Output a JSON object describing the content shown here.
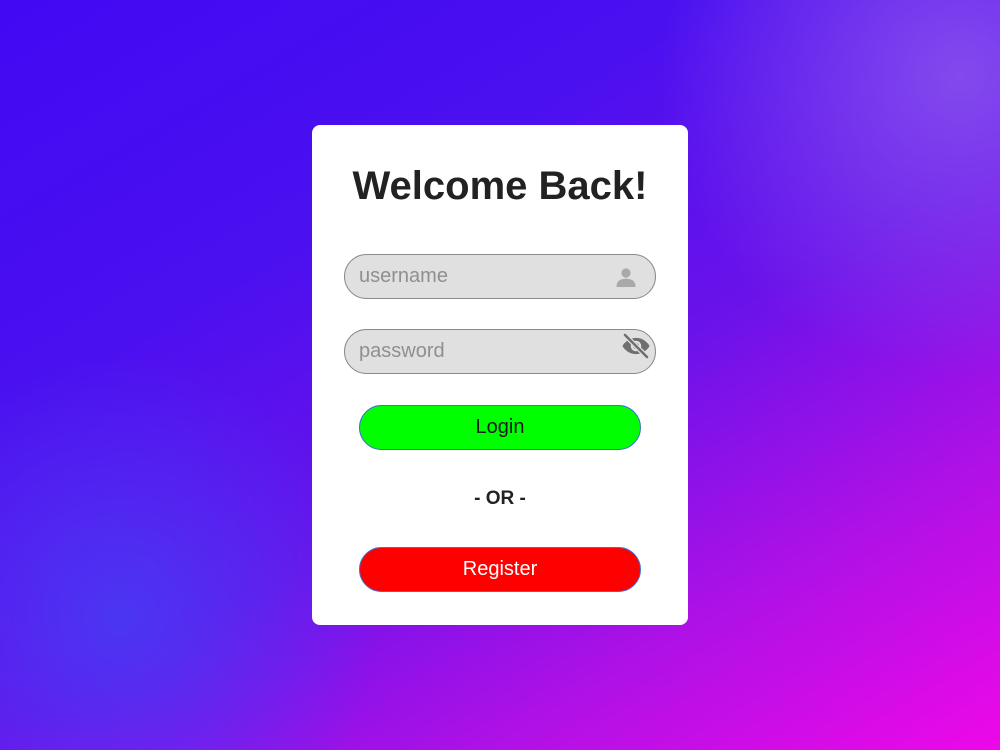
{
  "login_form": {
    "title": "Welcome Back!",
    "username": {
      "placeholder": "username",
      "value": "",
      "icon": "user-icon"
    },
    "password": {
      "placeholder": "password",
      "value": "",
      "icon": "eye-off-icon"
    },
    "login_label": "Login",
    "divider_text": "- OR -",
    "register_label": "Register"
  },
  "colors": {
    "background_start": "#4208f3",
    "background_end": "#ee08e8",
    "card": "#ffffff",
    "field": "#e0e0e0",
    "login_button": "#00ff00",
    "register_button": "#ff0000",
    "title_text": "#222222"
  }
}
